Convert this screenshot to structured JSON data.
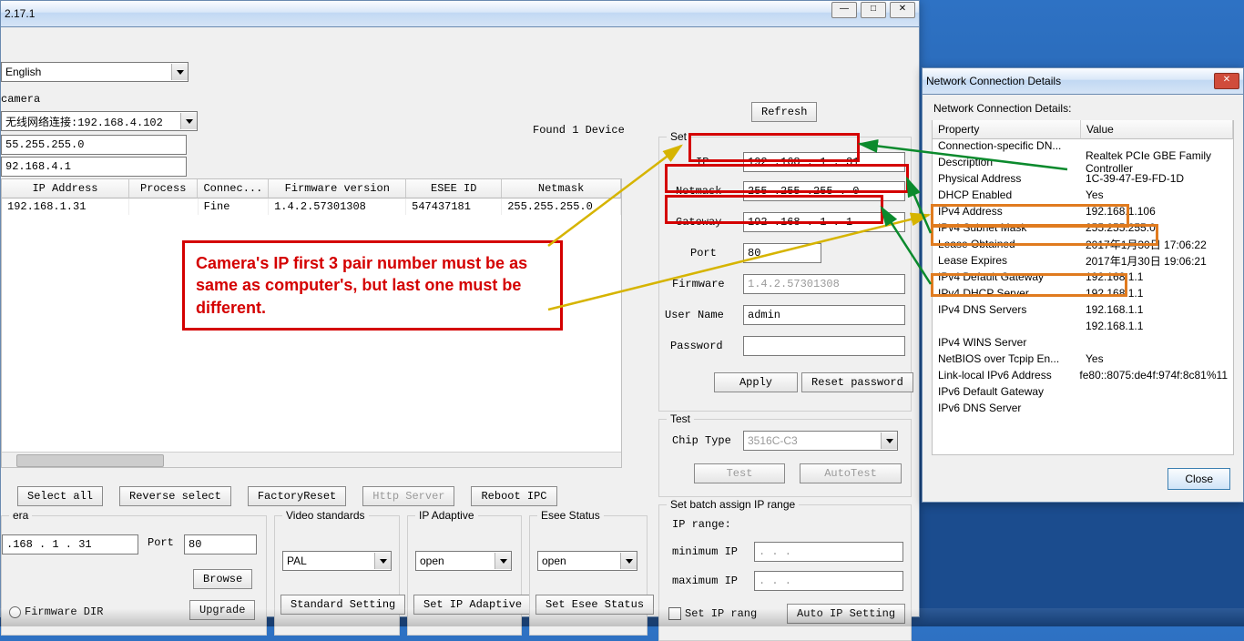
{
  "main": {
    "title": "2.17.1",
    "lang": "English",
    "camera_label": "camera",
    "nic": "无线网络连接:192.168.4.102",
    "local_mask": "55.255.255.0",
    "local_gw": "92.168.4.1",
    "found": "Found 1 Device",
    "table": {
      "headers": [
        "IP Address",
        "Process",
        "Connec...",
        "Firmware version",
        "ESEE ID",
        "Netmask"
      ],
      "row": [
        "192.168.1.31",
        "",
        "Fine",
        "1.4.2.57301308",
        "547437181",
        "255.255.255.0"
      ]
    },
    "buttons": {
      "select_all": "Select all",
      "reverse": "Reverse select",
      "factory": "FactoryReset",
      "http": "Http Server",
      "reboot": "Reboot IPC",
      "refresh": "Refresh"
    },
    "lower_left": {
      "legend": "era",
      "ip": ".168 . 1 . 31",
      "port_label": "Port",
      "port": "80",
      "browse": "Browse",
      "upgrade": "Upgrade",
      "firmware_dir": "Firmware DIR"
    },
    "video_std": {
      "legend": "Video standards",
      "value": "PAL",
      "btn": "Standard Setting"
    },
    "ip_adaptive": {
      "legend": "IP Adaptive",
      "value": "open",
      "btn": "Set IP Adaptive"
    },
    "esee": {
      "legend": "Esee Status",
      "value": "open",
      "btn": "Set Esee Status"
    }
  },
  "right": {
    "set": {
      "legend": "Set",
      "ip_lbl": "IP",
      "ip": "192 .168 . 1 . 31",
      "mask_lbl": "Netmask",
      "mask": "255 .255 .255 . 0",
      "gw_lbl": "Gateway",
      "gw": "192 .168 . 1 . 1",
      "port_lbl": "Port",
      "port": "80",
      "fw_lbl": "Firmware",
      "fw": "1.4.2.57301308",
      "user_lbl": "User Name",
      "user": "admin",
      "pwd_lbl": "Password",
      "pwd": "",
      "apply": "Apply",
      "reset": "Reset password"
    },
    "test": {
      "legend": "Test",
      "chip_lbl": "Chip Type",
      "chip": "3516C-C3",
      "test": "Test",
      "auto": "AutoTest"
    },
    "batch": {
      "legend": "Set batch assign IP range",
      "range_lbl": "IP range:",
      "min_lbl": "minimum IP",
      "max_lbl": "maximum IP",
      "chk": "Set IP rang",
      "auto": "Auto IP Setting"
    }
  },
  "netdetails": {
    "title": "Network Connection Details",
    "subtitle": "Network Connection Details:",
    "prop": "Property",
    "val": "Value",
    "rows": [
      [
        "Connection-specific DN...",
        ""
      ],
      [
        "Description",
        "Realtek PCIe GBE Family Controller"
      ],
      [
        "Physical Address",
        "1C-39-47-E9-FD-1D"
      ],
      [
        "DHCP Enabled",
        "Yes"
      ],
      [
        "IPv4 Address",
        "192.168.1.106"
      ],
      [
        "IPv4 Subnet Mask",
        "255.255.255.0"
      ],
      [
        "Lease Obtained",
        "2017年1月30日 17:06:22"
      ],
      [
        "Lease Expires",
        "2017年1月30日 19:06:21"
      ],
      [
        "IPv4 Default Gateway",
        "192.168.1.1"
      ],
      [
        "IPv4 DHCP Server",
        "192.168.1.1"
      ],
      [
        "IPv4 DNS Servers",
        "192.168.1.1"
      ],
      [
        "",
        "192.168.1.1"
      ],
      [
        "IPv4 WINS Server",
        ""
      ],
      [
        "NetBIOS over Tcpip En...",
        "Yes"
      ],
      [
        "Link-local IPv6 Address",
        "fe80::8075:de4f:974f:8c81%11"
      ],
      [
        "IPv6 Default Gateway",
        ""
      ],
      [
        "IPv6 DNS Server",
        ""
      ]
    ],
    "close": "Close"
  },
  "callout": "Camera's  IP first 3 pair number must  be as same as computer's, but last one must be different.",
  "annotations": {
    "red_boxes": [
      "set-ip",
      "set-netmask",
      "set-gateway"
    ],
    "orange_boxes": [
      "ipv4-address",
      "ipv4-subnet-mask",
      "ipv4-default-gateway"
    ]
  }
}
